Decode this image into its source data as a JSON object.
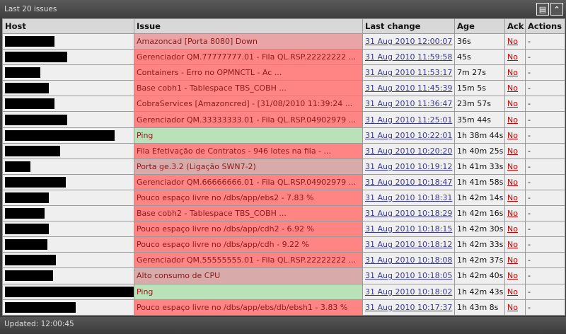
{
  "title": "Last 20 issues",
  "footer": "Updated: 12:00:45",
  "icons": [
    "menu-icon",
    "collapse-icon"
  ],
  "columns": [
    "Host",
    "Issue",
    "Last change",
    "Age",
    "Ack",
    "Actions"
  ],
  "rows": [
    {
      "issue": "Amazoncad [Porta 8080] Down",
      "sev": "avg",
      "last": "31 Aug 2010 12:00:07",
      "age": "36s",
      "ack": "No",
      "actions": "-"
    },
    {
      "issue": "Gerenciador QM.77777777.01 - Fila QL.RSP.22222222 ...",
      "sev": "red",
      "last": "31 Aug 2010 11:59:58",
      "age": "45s",
      "ack": "No",
      "actions": "-"
    },
    {
      "issue": "Containers - Erro no OPMNCTL - Ac ...",
      "sev": "red",
      "last": "31 Aug 2010 11:53:17",
      "age": "7m 27s",
      "ack": "No",
      "actions": "-"
    },
    {
      "issue": "Base cobh1 - Tablespace TBS_COBH  ...",
      "sev": "red",
      "last": "31 Aug 2010 11:45:39",
      "age": "15m 5s",
      "ack": "No",
      "actions": "-"
    },
    {
      "issue": "CobraServices [Amazoncred] - [31/08/2010 11:39:24 ...",
      "sev": "red",
      "last": "31 Aug 2010 11:36:47",
      "age": "23m 57s",
      "ack": "No",
      "actions": "-"
    },
    {
      "issue": "Gerenciador QM.33333333.01 - Fila QL.RSP.04902979 ...",
      "sev": "red",
      "last": "31 Aug 2010 11:25:01",
      "age": "35m 44s",
      "ack": "No",
      "actions": "-"
    },
    {
      "issue": "Ping",
      "sev": "ok",
      "last": "31 Aug 2010 10:22:01",
      "age": "1h 38m 44s",
      "ack": "No",
      "actions": "-"
    },
    {
      "issue": "Fila Efetivação de Contratos - 946 lotes na fila -  ...",
      "sev": "red",
      "last": "31 Aug 2010 10:20:20",
      "age": "1h 40m 25s",
      "ack": "No",
      "actions": "-"
    },
    {
      "issue": "Porta ge.3.2 (Ligação SWN7-2)",
      "sev": "gray",
      "last": "31 Aug 2010 10:19:12",
      "age": "1h 41m 33s",
      "ack": "No",
      "actions": "-"
    },
    {
      "issue": "Gerenciador QM.66666666.01 - Fila QL.RSP.04902979 ...",
      "sev": "red",
      "last": "31 Aug 2010 10:18:47",
      "age": "1h 41m 58s",
      "ack": "No",
      "actions": "-"
    },
    {
      "issue": "Pouco espaço livre no /dbs/app/ebs2 - 7.83 %",
      "sev": "red",
      "last": "31 Aug 2010 10:18:31",
      "age": "1h 42m 14s",
      "ack": "No",
      "actions": "-"
    },
    {
      "issue": "Base cobh2 - Tablespace TBS_COBH  ...",
      "sev": "red",
      "last": "31 Aug 2010 10:18:29",
      "age": "1h 42m 16s",
      "ack": "No",
      "actions": "-"
    },
    {
      "issue": "Pouco espaço livre no /dbs/app/cdh2 - 6.92 %",
      "sev": "red",
      "last": "31 Aug 2010 10:18:15",
      "age": "1h 42m 30s",
      "ack": "No",
      "actions": "-"
    },
    {
      "issue": "Pouco espaço livre no /dbs/app/cdh - 9.22 %",
      "sev": "red",
      "last": "31 Aug 2010 10:18:12",
      "age": "1h 42m 33s",
      "ack": "No",
      "actions": "-"
    },
    {
      "issue": "Gerenciador QM.55555555.01 - Fila QL.RSP.22222222 ...",
      "sev": "red",
      "last": "31 Aug 2010 10:18:08",
      "age": "1h 42m 37s",
      "ack": "No",
      "actions": "-"
    },
    {
      "issue": "Alto consumo de CPU",
      "sev": "gray",
      "last": "31 Aug 2010 10:18:05",
      "age": "1h 42m 40s",
      "ack": "No",
      "actions": "-"
    },
    {
      "issue": "Ping",
      "sev": "ok",
      "last": "31 Aug 2010 10:18:02",
      "age": "1h 42m 43s",
      "ack": "No",
      "actions": "-"
    },
    {
      "issue": "Pouco espaço livre no /dbs/app/ebs/db/ebsh1 - 3.83 %",
      "sev": "red",
      "last": "31 Aug 2010 10:17:37",
      "age": "1h 43m 8s",
      "ack": "No",
      "actions": "-"
    }
  ]
}
